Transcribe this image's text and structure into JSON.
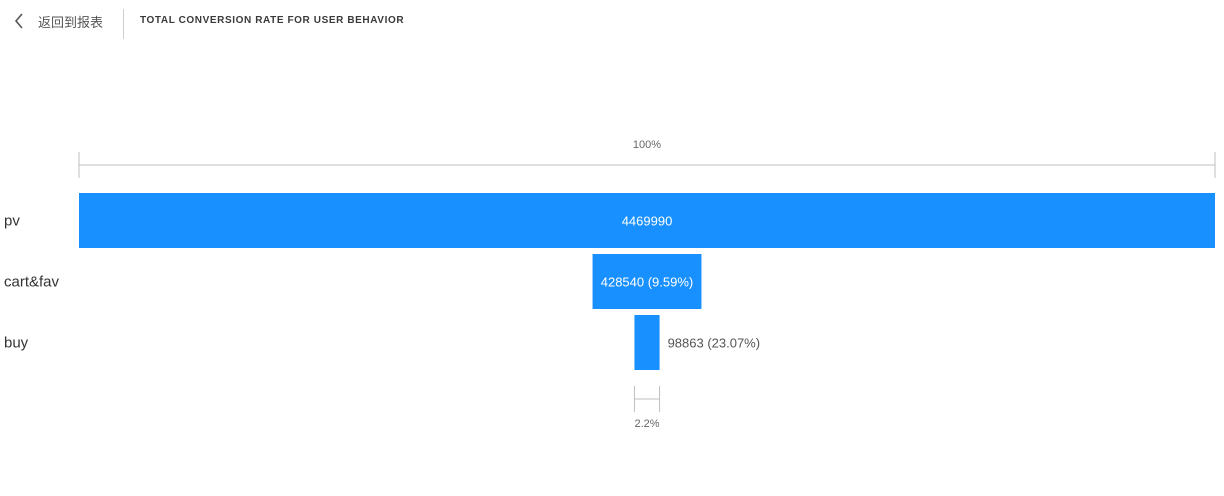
{
  "header": {
    "back_label": "返回到报表",
    "title": "TOTAL CONVERSION RATE FOR USER BEHAVIOR",
    "corner_mark": "˚"
  },
  "colors": {
    "bar": "#1890ff",
    "axis": "#bfbfbf",
    "text": "#333333"
  },
  "chart_data": {
    "type": "bar",
    "orientation": "horizontal-funnel",
    "categories": [
      "pv",
      "cart&fav",
      "buy"
    ],
    "values": [
      4469990,
      428540,
      98863
    ],
    "value_labels": [
      "4469990",
      "428540 (9.59%)",
      "98863 (23.07%)"
    ],
    "step_rates": [
      null,
      9.59,
      23.07
    ],
    "top_bracket_label": "100%",
    "bottom_bracket_label": "2.2%",
    "title": "TOTAL CONVERSION RATE FOR USER BEHAVIOR",
    "xlabel": "",
    "ylabel": ""
  }
}
